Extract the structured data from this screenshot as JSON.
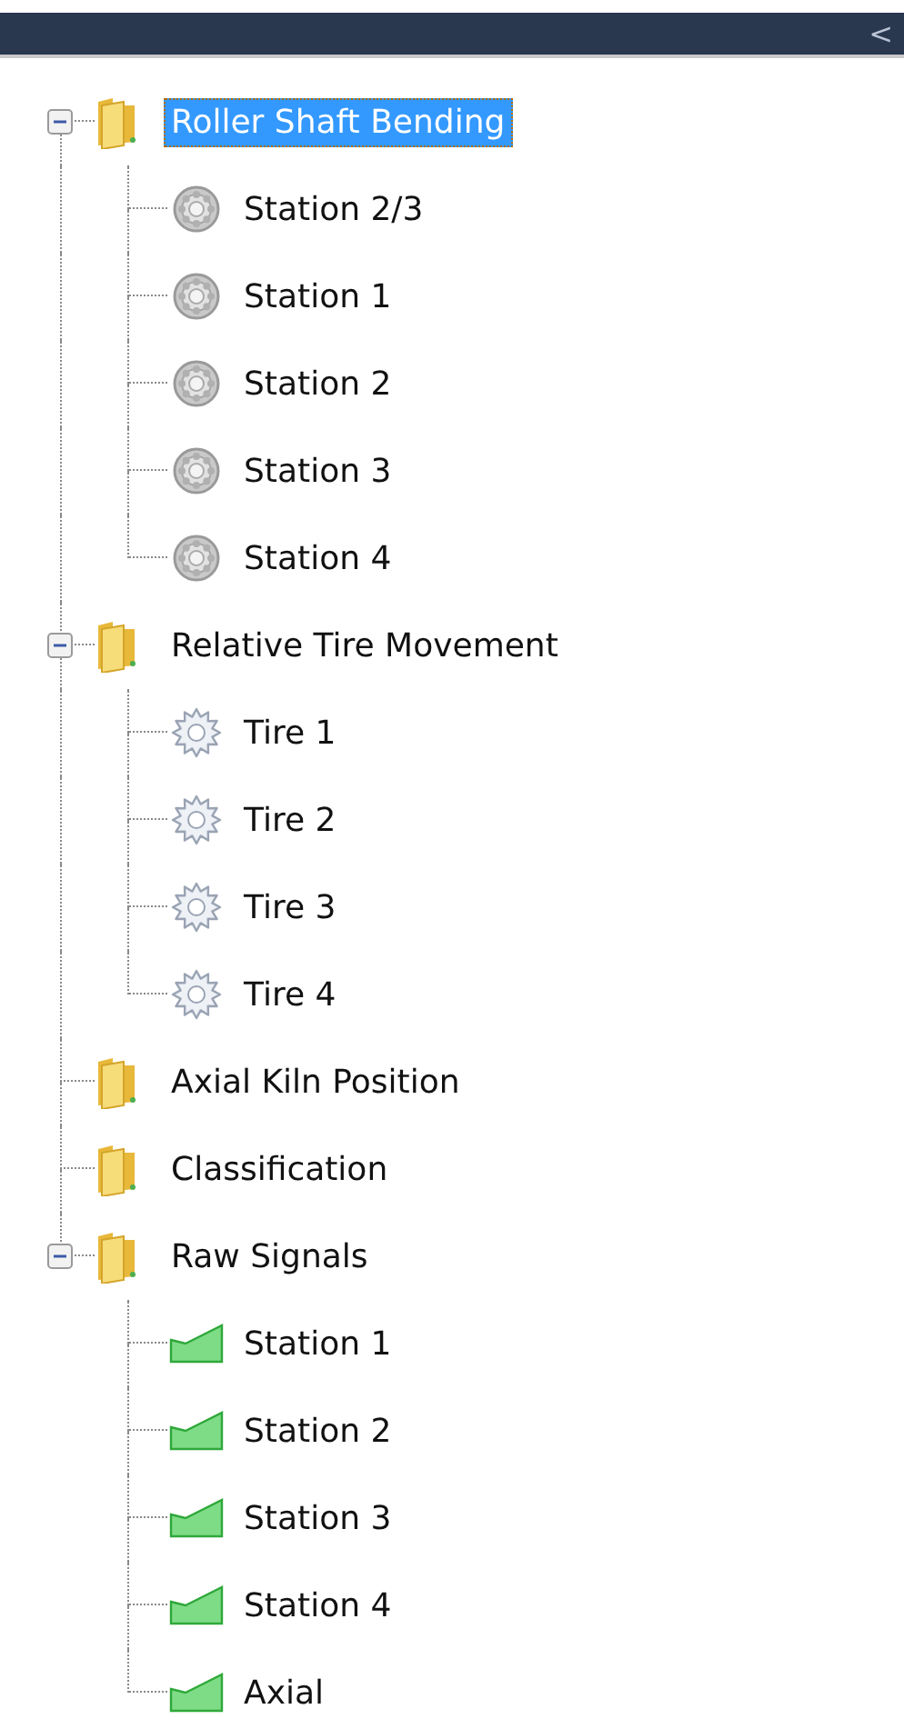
{
  "header": {
    "collapse_button": "<"
  },
  "tree": [
    {
      "label": "Roller Shaft Bending",
      "selected": true,
      "expanded": true,
      "children": [
        {
          "label": "Station 2/3",
          "kind": "bearing",
          "selected": false
        },
        {
          "label": "Station 1",
          "kind": "bearing",
          "selected": false
        },
        {
          "label": "Station 2",
          "kind": "bearing",
          "selected": false
        },
        {
          "label": "Station 3",
          "kind": "bearing",
          "selected": false
        },
        {
          "label": "Station 4",
          "kind": "bearing",
          "selected": false
        }
      ]
    },
    {
      "label": "Relative Tire Movement",
      "selected": false,
      "expanded": true,
      "children": [
        {
          "label": "Tire 1",
          "kind": "gear",
          "selected": false
        },
        {
          "label": "Tire 2",
          "kind": "gear",
          "selected": false
        },
        {
          "label": "Tire 3",
          "kind": "gear",
          "selected": false
        },
        {
          "label": "Tire 4",
          "kind": "gear",
          "selected": false
        }
      ]
    },
    {
      "label": "Axial Kiln Position",
      "selected": false
    },
    {
      "label": "Classification",
      "selected": false
    },
    {
      "label": "Raw Signals",
      "selected": false,
      "expanded": true,
      "children": [
        {
          "label": "Station 1",
          "kind": "signal",
          "selected": false
        },
        {
          "label": "Station 2",
          "kind": "signal",
          "selected": false
        },
        {
          "label": "Station 3",
          "kind": "signal",
          "selected": false
        },
        {
          "label": "Station 4",
          "kind": "signal",
          "selected": false
        },
        {
          "label": "Axial",
          "kind": "signal",
          "selected": false
        }
      ]
    }
  ]
}
